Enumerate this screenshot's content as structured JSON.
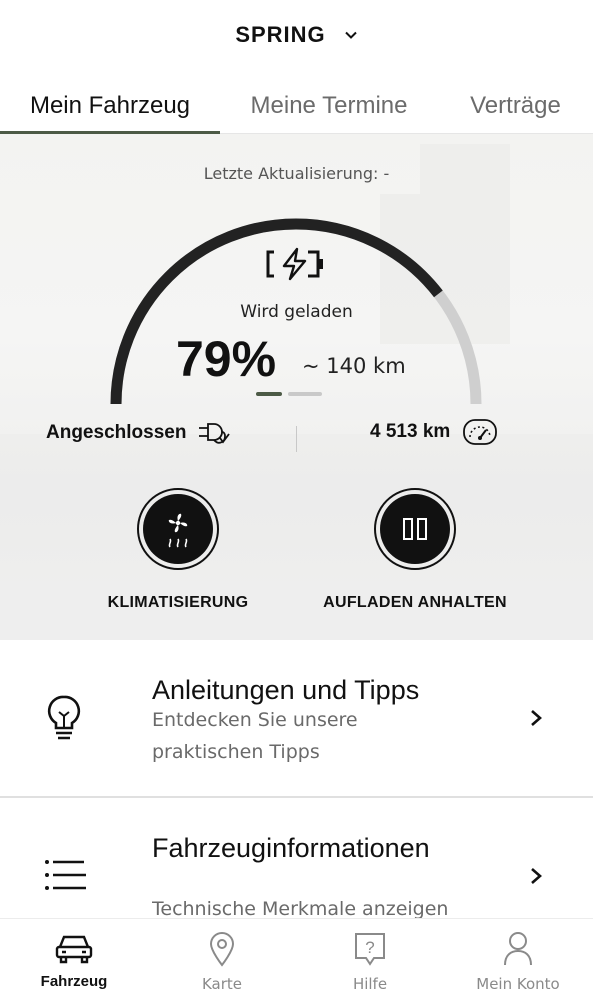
{
  "header": {
    "model_name": "SPRING",
    "chevron_icon": "chevron-down-icon"
  },
  "tabs": [
    {
      "label": "Mein Fahrzeug",
      "active": true
    },
    {
      "label": "Meine Termine",
      "active": false
    },
    {
      "label": "Verträge",
      "active": false
    }
  ],
  "status": {
    "last_update": "Letzte Aktualisierung:  -",
    "charging_label": "Wird geladen",
    "battery_percent": "79%",
    "battery_fraction": 0.79,
    "range": "~ 140 km",
    "plug_status": "Angeschlossen",
    "odometer": "4 513 km",
    "carousel_pages": 2,
    "carousel_active": 0
  },
  "actions": [
    {
      "label": "KLIMATISIERUNG",
      "icon": "fan-heat-icon"
    },
    {
      "label": "AUFLADEN ANHALTEN",
      "icon": "pause-icon"
    }
  ],
  "cards": [
    {
      "title": "Anleitungen und Tipps",
      "subtitle": "Entdecken Sie unsere praktischen Tipps",
      "icon": "lightbulb-icon"
    },
    {
      "title": "Fahrzeuginformationen",
      "subtitle": "Technische Merkmale anzeigen",
      "icon": "list-icon"
    }
  ],
  "bottom_nav": [
    {
      "label": "Fahrzeug",
      "icon": "car-icon",
      "active": true
    },
    {
      "label": "Karte",
      "icon": "map-pin-icon",
      "active": false
    },
    {
      "label": "Hilfe",
      "icon": "help-icon",
      "active": false
    },
    {
      "label": "Mein Konto",
      "icon": "user-icon",
      "active": false
    }
  ],
  "colors": {
    "accent": "#4c5a46",
    "gauge_fill": "#222222",
    "gauge_track": "#cfcfcf"
  }
}
